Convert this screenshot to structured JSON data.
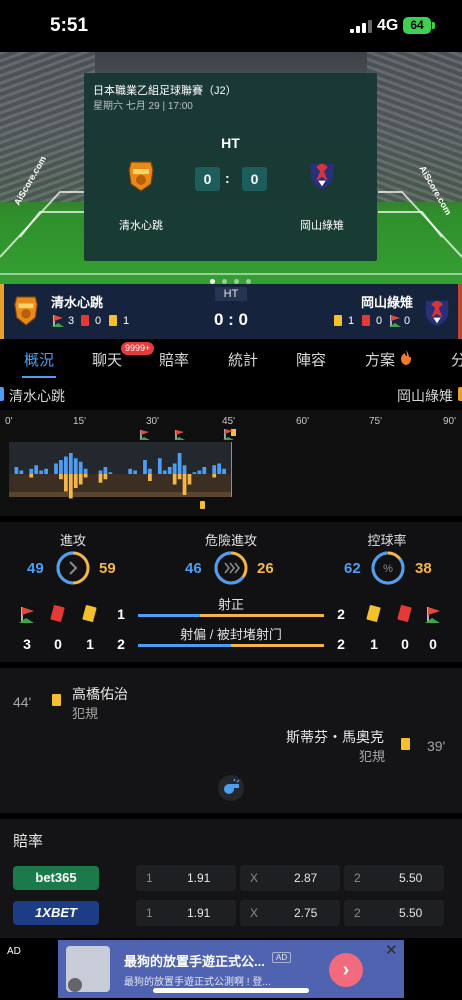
{
  "status_bar": {
    "time": "5:51",
    "network": "4G",
    "battery": "64"
  },
  "match_card": {
    "league": "日本職業乙組足球聯賽（J2）",
    "datetime": "星期六 七月 29 | 17:00",
    "status": "HT",
    "home_score": "0",
    "away_score": "0",
    "separator": ":",
    "home_team": "清水心跳",
    "away_team": "岡山綠雉",
    "watermark_left": "AiScore.com",
    "watermark_right": "AiScore.com"
  },
  "team_bar": {
    "home_team": "清水心跳",
    "away_team": "岡山綠雉",
    "status": "HT",
    "score": "0 : 0",
    "home_corners": "3",
    "home_red": "0",
    "home_yellow": "1",
    "away_yellow": "1",
    "away_red": "0",
    "away_corners": "0"
  },
  "tabs": [
    {
      "label": "概況"
    },
    {
      "label": "聊天"
    },
    {
      "label": "賠率"
    },
    {
      "label": "統計"
    },
    {
      "label": "陣容"
    },
    {
      "label": "方案"
    },
    {
      "label": "分"
    }
  ],
  "chat_badge": "9999+",
  "names_row": {
    "home": "清水心跳",
    "away": "岡山綠雉"
  },
  "timeline": {
    "minute_labels": [
      "0'",
      "15'",
      "30'",
      "45'",
      "60'",
      "75'",
      "90'"
    ]
  },
  "chart_data": {
    "type": "bar",
    "title": "",
    "x_range": [
      0,
      90
    ],
    "current_minute": 45,
    "home_momentum": [
      0,
      4,
      2,
      0,
      3,
      5,
      2,
      3,
      0,
      6,
      8,
      10,
      12,
      9,
      7,
      3,
      0,
      0,
      2,
      4,
      1,
      0,
      0,
      0,
      3,
      2,
      0,
      8,
      3,
      0,
      9,
      2,
      4,
      6,
      12,
      5,
      0,
      1,
      2,
      4,
      0,
      5,
      6,
      3,
      0
    ],
    "away_momentum": [
      0,
      0,
      0,
      0,
      2,
      0,
      0,
      0,
      0,
      0,
      3,
      10,
      14,
      8,
      6,
      2,
      0,
      0,
      5,
      3,
      0,
      0,
      0,
      0,
      0,
      0,
      0,
      0,
      4,
      0,
      0,
      0,
      0,
      6,
      3,
      12,
      6,
      0,
      0,
      0,
      0,
      2,
      0,
      0,
      0
    ],
    "home_color": "#4d9ef2",
    "away_color": "#f4b64a"
  },
  "stats": {
    "attack": {
      "label": "進攻",
      "home": "49",
      "away": "59"
    },
    "dangerous": {
      "label": "危險進攻",
      "home": "46",
      "away": "26"
    },
    "possession": {
      "label": "控球率",
      "home": "62",
      "away": "38",
      "symbol": "%"
    },
    "shots_on": {
      "label": "射正",
      "home": "1",
      "away": "2"
    },
    "shots_off": {
      "label": "射偏 / 被封堵射门",
      "home": "2",
      "away": "2"
    },
    "home_corners": "3",
    "home_red": "0",
    "home_yellow": "1",
    "away_yellow": "1",
    "away_red": "0",
    "away_corners": "0"
  },
  "events": [
    {
      "minute": "44'",
      "player": "高橋佑治",
      "type": "犯規",
      "side": "home"
    },
    {
      "minute": "39'",
      "player": "斯蒂芬・馬奧克",
      "type": "犯規",
      "side": "away"
    }
  ],
  "odds": {
    "title": "賠率",
    "rows": [
      {
        "bookmaker": "bet365",
        "label1": "1",
        "v1": "1.91",
        "labelx": "X",
        "vx": "2.87",
        "label2": "2",
        "v2": "5.50"
      },
      {
        "bookmaker": "1XBET",
        "label1": "1",
        "v1": "1.91",
        "labelx": "X",
        "vx": "2.75",
        "label2": "2",
        "v2": "5.50"
      }
    ]
  },
  "ad": {
    "label": "AD",
    "title": "最狗的放置手遊正式公...",
    "tag": "AD",
    "subtitle": "最狗的放置手遊正式公測啊 ! 登...",
    "close": "✕"
  }
}
